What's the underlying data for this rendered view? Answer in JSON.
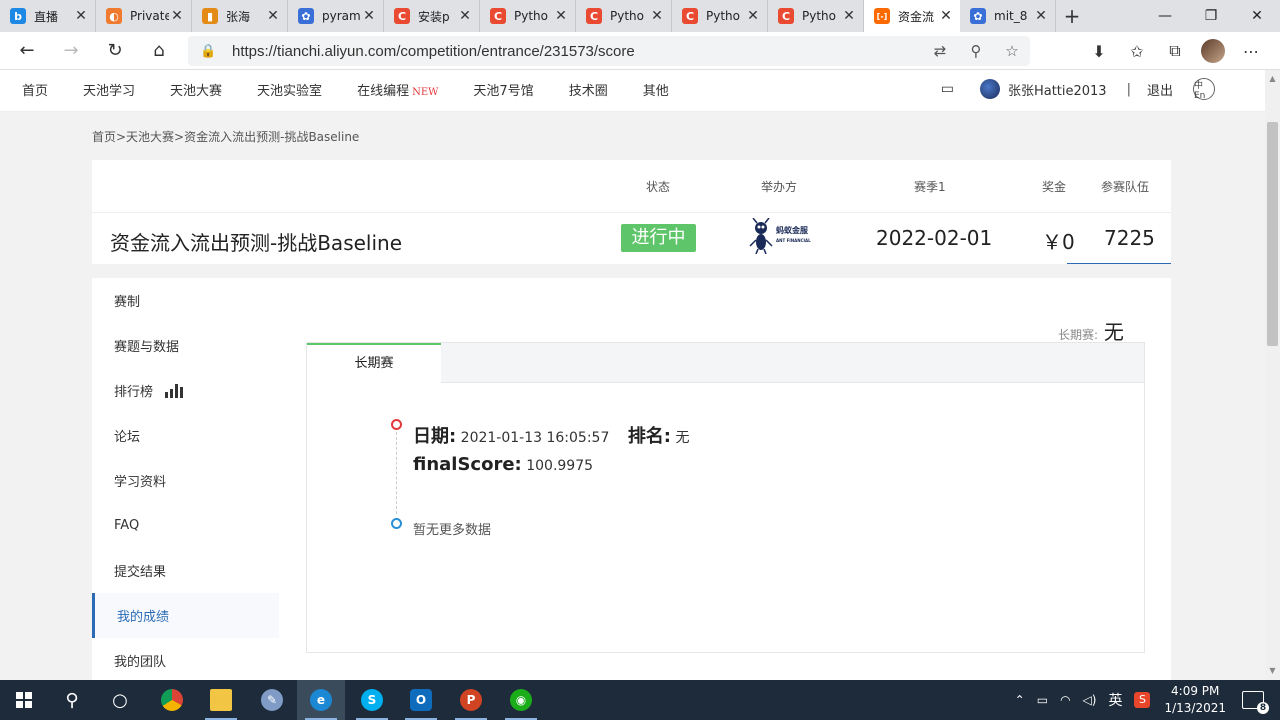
{
  "browser": {
    "tabs": [
      {
        "label": "直播",
        "icon": "bilibili-icon",
        "color": "#1e88e5",
        "glyph": "b"
      },
      {
        "label": "Private",
        "icon": "edge-icon",
        "color": "#f07a2e",
        "glyph": "◐"
      },
      {
        "label": "张海",
        "icon": "book-icon",
        "color": "#e38b16",
        "glyph": "▮"
      },
      {
        "label": "pyrami",
        "icon": "baidu-paw-icon",
        "color": "#3a6fd8",
        "glyph": "✿"
      },
      {
        "label": "安装p",
        "icon": "csdn-icon",
        "color": "#ea4a32",
        "glyph": "C"
      },
      {
        "label": "Pytho",
        "icon": "csdn-icon",
        "color": "#ea4a32",
        "glyph": "C"
      },
      {
        "label": "Pytho",
        "icon": "csdn-icon",
        "color": "#ea4a32",
        "glyph": "C"
      },
      {
        "label": "Pytho",
        "icon": "csdn-icon",
        "color": "#ea4a32",
        "glyph": "C"
      },
      {
        "label": "Pytho",
        "icon": "csdn-icon",
        "color": "#ea4a32",
        "glyph": "C"
      },
      {
        "label": "资金流",
        "icon": "tianchi-icon",
        "color": "#ff6a00",
        "glyph": "[-]"
      },
      {
        "label": "mit_8",
        "icon": "baidu-paw-icon",
        "color": "#3a6fd8",
        "glyph": "✿"
      }
    ],
    "active_tab_index": 9,
    "url": "https://tianchi.aliyun.com/competition/entrance/231573/score"
  },
  "site_nav": {
    "items": [
      "首页",
      "天池学习",
      "天池大赛",
      "天池实验室",
      "在线编程",
      "天池7号馆",
      "技术圈",
      "其他"
    ],
    "new_tag": "NEW",
    "username": "张张Hattie2013",
    "separator": "|",
    "logout": "退出",
    "lang": "中En"
  },
  "breadcrumb": "首页>天池大赛>资金流入流出预测-挑战Baseline",
  "competition": {
    "headers": {
      "status": "状态",
      "organizer": "举办方",
      "season": "赛季1",
      "prize": "奖金",
      "teams": "参赛队伍"
    },
    "title": "资金流入流出预测-挑战Baseline",
    "status": "进行中",
    "organizer_logo_text": "蚂蚁金服",
    "organizer_logo_sub": "ANT FINANCIAL",
    "season_date": "2022-02-01",
    "prize": "￥0",
    "teams": "7225"
  },
  "sidebar": {
    "items": [
      "赛制",
      "赛题与数据",
      "排行榜",
      "论坛",
      "学习资料",
      "FAQ",
      "提交结果",
      "我的成绩",
      "我的团队"
    ],
    "active_index": 7
  },
  "score": {
    "long_term_label": "长期赛:",
    "long_term_value": "无",
    "tab_label": "长期赛",
    "date_label": "日期:",
    "date_value": "2021-01-13 16:05:57",
    "rank_label": "排名:",
    "rank_value": "无",
    "score_label": "finalScore:",
    "score_value": "100.9975",
    "empty_text": "暂无更多数据"
  },
  "taskbar": {
    "ime": "英",
    "time": "4:09 PM",
    "date": "1/13/2021",
    "notifications": "8"
  },
  "colors": {
    "accent_green": "#5ec56a",
    "accent_blue": "#2b6bb5",
    "timeline_red": "#e4393c"
  }
}
